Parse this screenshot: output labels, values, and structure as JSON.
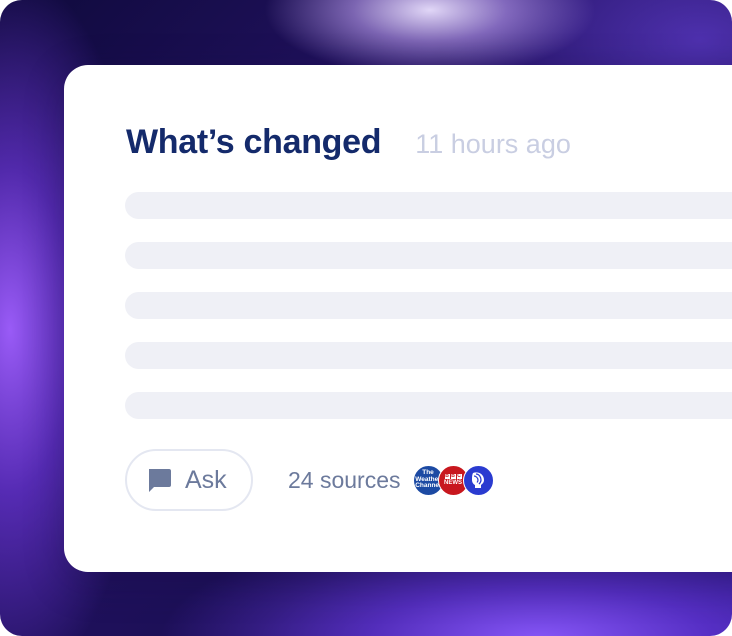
{
  "card": {
    "title": "What’s changed",
    "timestamp": "11 hours ago",
    "placeholder_line_count": 5
  },
  "footer": {
    "ask_label": "Ask",
    "ask_icon": "chat-bubble-icon",
    "sources_label": "24 sources",
    "source_logos": [
      {
        "name": "The Weather Channel",
        "icon": "weather-channel-logo",
        "color": "#1c4aa3"
      },
      {
        "name": "BBC News",
        "icon": "bbc-news-logo",
        "color": "#c8171e"
      },
      {
        "name": "PBS",
        "icon": "pbs-logo",
        "color": "#2a3bd0"
      }
    ]
  },
  "colors": {
    "title": "#142a6b",
    "timestamp": "#c9cee2",
    "placeholder_bar": "#eff0f6",
    "muted_text": "#6c7a9c",
    "background_accent": "#7b4dff"
  }
}
